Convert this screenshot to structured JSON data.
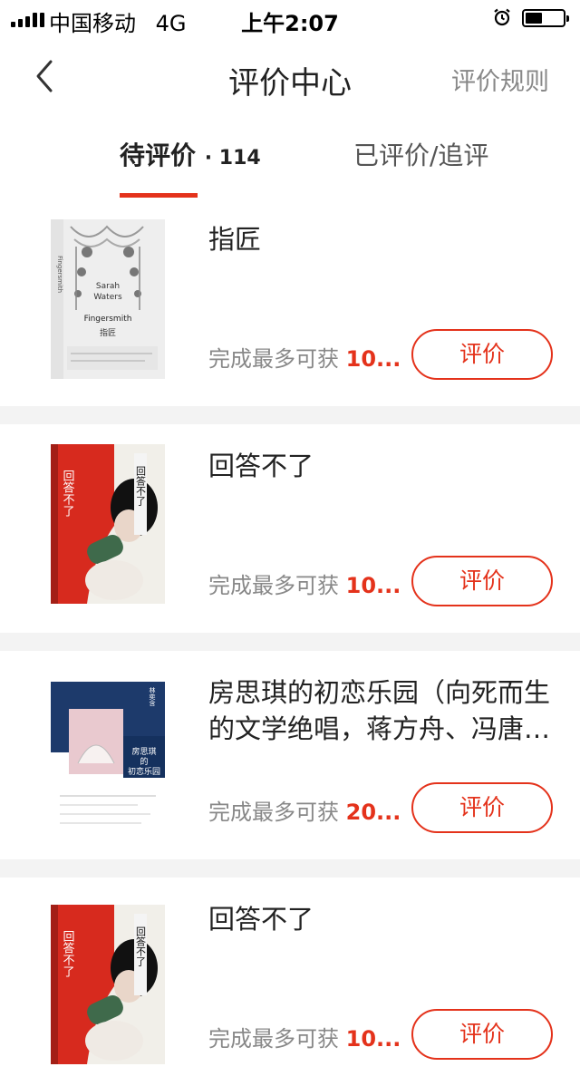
{
  "status": {
    "carrier": "中国移动",
    "network": "4G",
    "time": "上午2:07"
  },
  "nav": {
    "title": "评价中心",
    "right": "评价规则"
  },
  "tabs": [
    {
      "label": "待评价",
      "count": "· 114"
    },
    {
      "label": "已评价/追评"
    }
  ],
  "items": [
    {
      "title": "指匠",
      "reward_label": "完成最多可获",
      "reward_value": "10...",
      "button": "评价",
      "cover": {
        "style": "white",
        "lines": [
          "Sarah",
          "Waters"
        ],
        "title_en": "Fingersmith",
        "title_cn": "指匠",
        "spine_text": "Fingersmith"
      }
    },
    {
      "title": "回答不了",
      "reward_label": "完成最多可获",
      "reward_value": "10...",
      "button": "评价",
      "cover": {
        "style": "red",
        "vertical": "回答不了"
      }
    },
    {
      "title": "房思琪的初恋乐园（向死而生的文学绝唱，蒋方舟、冯唐…",
      "reward_label": "完成最多可获",
      "reward_value": "20...",
      "button": "评价",
      "cover": {
        "style": "navy",
        "lines": [
          "房思琪",
          "的",
          "初恋乐园"
        ],
        "side": "林奕含"
      }
    },
    {
      "title": "回答不了",
      "reward_label": "完成最多可获",
      "reward_value": "10...",
      "button": "评价",
      "cover": {
        "style": "red",
        "vertical": "回答不了"
      }
    }
  ],
  "colors": {
    "accent": "#e4321b",
    "muted": "#888888",
    "divider": "#f3f3f3"
  },
  "icons": {
    "back": "chevron-left-icon",
    "alarm": "alarm-icon",
    "battery": "battery-icon",
    "signal": "signal-icon"
  }
}
